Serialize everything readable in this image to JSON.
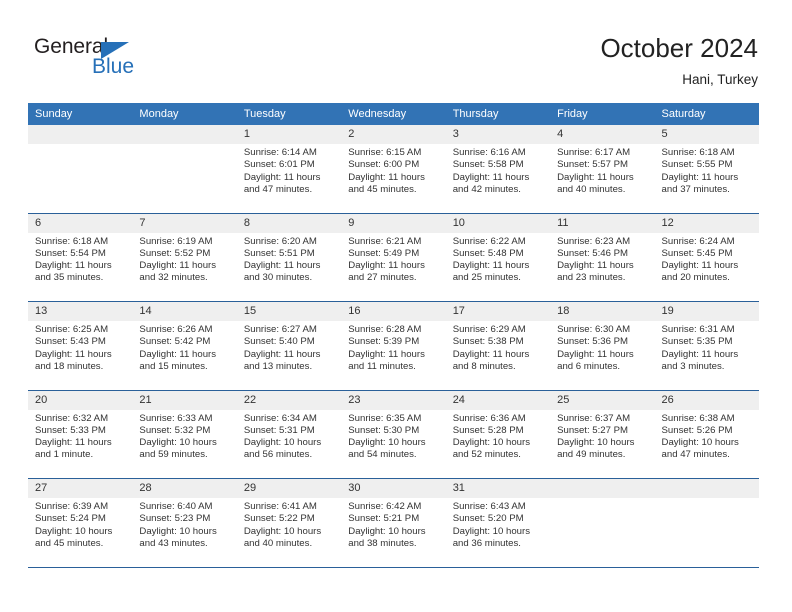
{
  "brand": {
    "name_part1": "General",
    "name_part2": "Blue",
    "accent_color": "#2670b8"
  },
  "header": {
    "title": "October 2024",
    "subtitle": "Hani, Turkey"
  },
  "calendar": {
    "header_bg": "#3273b5",
    "row_divider_color": "#2a6099",
    "daynumber_bg": "#efefef",
    "weekday_headers": [
      "Sunday",
      "Monday",
      "Tuesday",
      "Wednesday",
      "Thursday",
      "Friday",
      "Saturday"
    ],
    "weeks": [
      [
        {
          "day": "",
          "sunrise": "",
          "sunset": "",
          "daylight": "",
          "empty": true
        },
        {
          "day": "",
          "sunrise": "",
          "sunset": "",
          "daylight": "",
          "empty": true
        },
        {
          "day": "1",
          "sunrise": "Sunrise: 6:14 AM",
          "sunset": "Sunset: 6:01 PM",
          "daylight": "Daylight: 11 hours and 47 minutes."
        },
        {
          "day": "2",
          "sunrise": "Sunrise: 6:15 AM",
          "sunset": "Sunset: 6:00 PM",
          "daylight": "Daylight: 11 hours and 45 minutes."
        },
        {
          "day": "3",
          "sunrise": "Sunrise: 6:16 AM",
          "sunset": "Sunset: 5:58 PM",
          "daylight": "Daylight: 11 hours and 42 minutes."
        },
        {
          "day": "4",
          "sunrise": "Sunrise: 6:17 AM",
          "sunset": "Sunset: 5:57 PM",
          "daylight": "Daylight: 11 hours and 40 minutes."
        },
        {
          "day": "5",
          "sunrise": "Sunrise: 6:18 AM",
          "sunset": "Sunset: 5:55 PM",
          "daylight": "Daylight: 11 hours and 37 minutes."
        }
      ],
      [
        {
          "day": "6",
          "sunrise": "Sunrise: 6:18 AM",
          "sunset": "Sunset: 5:54 PM",
          "daylight": "Daylight: 11 hours and 35 minutes."
        },
        {
          "day": "7",
          "sunrise": "Sunrise: 6:19 AM",
          "sunset": "Sunset: 5:52 PM",
          "daylight": "Daylight: 11 hours and 32 minutes."
        },
        {
          "day": "8",
          "sunrise": "Sunrise: 6:20 AM",
          "sunset": "Sunset: 5:51 PM",
          "daylight": "Daylight: 11 hours and 30 minutes."
        },
        {
          "day": "9",
          "sunrise": "Sunrise: 6:21 AM",
          "sunset": "Sunset: 5:49 PM",
          "daylight": "Daylight: 11 hours and 27 minutes."
        },
        {
          "day": "10",
          "sunrise": "Sunrise: 6:22 AM",
          "sunset": "Sunset: 5:48 PM",
          "daylight": "Daylight: 11 hours and 25 minutes."
        },
        {
          "day": "11",
          "sunrise": "Sunrise: 6:23 AM",
          "sunset": "Sunset: 5:46 PM",
          "daylight": "Daylight: 11 hours and 23 minutes."
        },
        {
          "day": "12",
          "sunrise": "Sunrise: 6:24 AM",
          "sunset": "Sunset: 5:45 PM",
          "daylight": "Daylight: 11 hours and 20 minutes."
        }
      ],
      [
        {
          "day": "13",
          "sunrise": "Sunrise: 6:25 AM",
          "sunset": "Sunset: 5:43 PM",
          "daylight": "Daylight: 11 hours and 18 minutes."
        },
        {
          "day": "14",
          "sunrise": "Sunrise: 6:26 AM",
          "sunset": "Sunset: 5:42 PM",
          "daylight": "Daylight: 11 hours and 15 minutes."
        },
        {
          "day": "15",
          "sunrise": "Sunrise: 6:27 AM",
          "sunset": "Sunset: 5:40 PM",
          "daylight": "Daylight: 11 hours and 13 minutes."
        },
        {
          "day": "16",
          "sunrise": "Sunrise: 6:28 AM",
          "sunset": "Sunset: 5:39 PM",
          "daylight": "Daylight: 11 hours and 11 minutes."
        },
        {
          "day": "17",
          "sunrise": "Sunrise: 6:29 AM",
          "sunset": "Sunset: 5:38 PM",
          "daylight": "Daylight: 11 hours and 8 minutes."
        },
        {
          "day": "18",
          "sunrise": "Sunrise: 6:30 AM",
          "sunset": "Sunset: 5:36 PM",
          "daylight": "Daylight: 11 hours and 6 minutes."
        },
        {
          "day": "19",
          "sunrise": "Sunrise: 6:31 AM",
          "sunset": "Sunset: 5:35 PM",
          "daylight": "Daylight: 11 hours and 3 minutes."
        }
      ],
      [
        {
          "day": "20",
          "sunrise": "Sunrise: 6:32 AM",
          "sunset": "Sunset: 5:33 PM",
          "daylight": "Daylight: 11 hours and 1 minute."
        },
        {
          "day": "21",
          "sunrise": "Sunrise: 6:33 AM",
          "sunset": "Sunset: 5:32 PM",
          "daylight": "Daylight: 10 hours and 59 minutes."
        },
        {
          "day": "22",
          "sunrise": "Sunrise: 6:34 AM",
          "sunset": "Sunset: 5:31 PM",
          "daylight": "Daylight: 10 hours and 56 minutes."
        },
        {
          "day": "23",
          "sunrise": "Sunrise: 6:35 AM",
          "sunset": "Sunset: 5:30 PM",
          "daylight": "Daylight: 10 hours and 54 minutes."
        },
        {
          "day": "24",
          "sunrise": "Sunrise: 6:36 AM",
          "sunset": "Sunset: 5:28 PM",
          "daylight": "Daylight: 10 hours and 52 minutes."
        },
        {
          "day": "25",
          "sunrise": "Sunrise: 6:37 AM",
          "sunset": "Sunset: 5:27 PM",
          "daylight": "Daylight: 10 hours and 49 minutes."
        },
        {
          "day": "26",
          "sunrise": "Sunrise: 6:38 AM",
          "sunset": "Sunset: 5:26 PM",
          "daylight": "Daylight: 10 hours and 47 minutes."
        }
      ],
      [
        {
          "day": "27",
          "sunrise": "Sunrise: 6:39 AM",
          "sunset": "Sunset: 5:24 PM",
          "daylight": "Daylight: 10 hours and 45 minutes."
        },
        {
          "day": "28",
          "sunrise": "Sunrise: 6:40 AM",
          "sunset": "Sunset: 5:23 PM",
          "daylight": "Daylight: 10 hours and 43 minutes."
        },
        {
          "day": "29",
          "sunrise": "Sunrise: 6:41 AM",
          "sunset": "Sunset: 5:22 PM",
          "daylight": "Daylight: 10 hours and 40 minutes."
        },
        {
          "day": "30",
          "sunrise": "Sunrise: 6:42 AM",
          "sunset": "Sunset: 5:21 PM",
          "daylight": "Daylight: 10 hours and 38 minutes."
        },
        {
          "day": "31",
          "sunrise": "Sunrise: 6:43 AM",
          "sunset": "Sunset: 5:20 PM",
          "daylight": "Daylight: 10 hours and 36 minutes."
        },
        {
          "day": "",
          "sunrise": "",
          "sunset": "",
          "daylight": "",
          "empty": true
        },
        {
          "day": "",
          "sunrise": "",
          "sunset": "",
          "daylight": "",
          "empty": true
        }
      ]
    ]
  }
}
